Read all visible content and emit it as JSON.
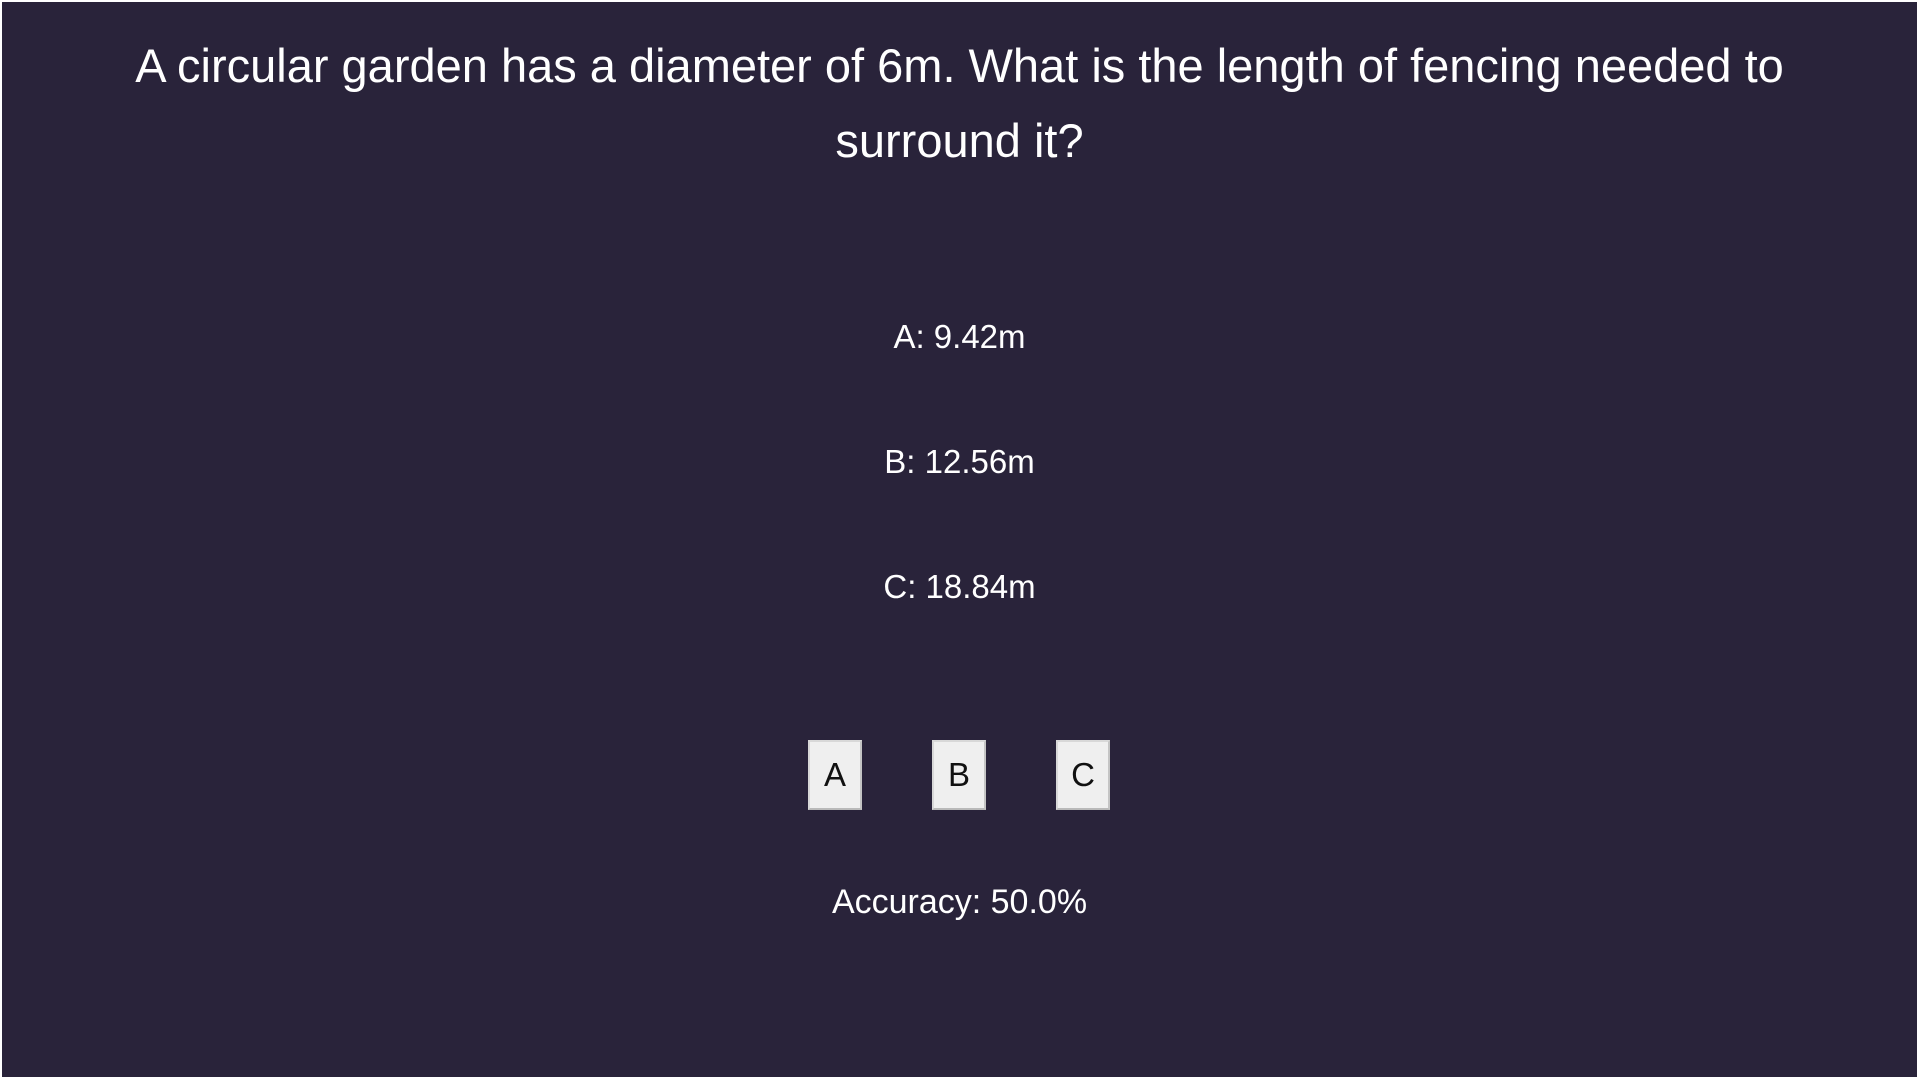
{
  "question": {
    "text": "A circular garden has a diameter of 6m. What is the length of fencing needed to surround it?"
  },
  "options": [
    {
      "text": "A: 9.42m"
    },
    {
      "text": "B: 12.56m"
    },
    {
      "text": "C: 18.84m"
    }
  ],
  "buttons": [
    {
      "label": "A"
    },
    {
      "label": "B"
    },
    {
      "label": "C"
    }
  ],
  "status": {
    "accuracy_text": "Accuracy: 50.0%",
    "accuracy_value": 50.0
  },
  "colors": {
    "background": "#29233a",
    "text": "#ffffff",
    "button_bg": "#efefef"
  }
}
